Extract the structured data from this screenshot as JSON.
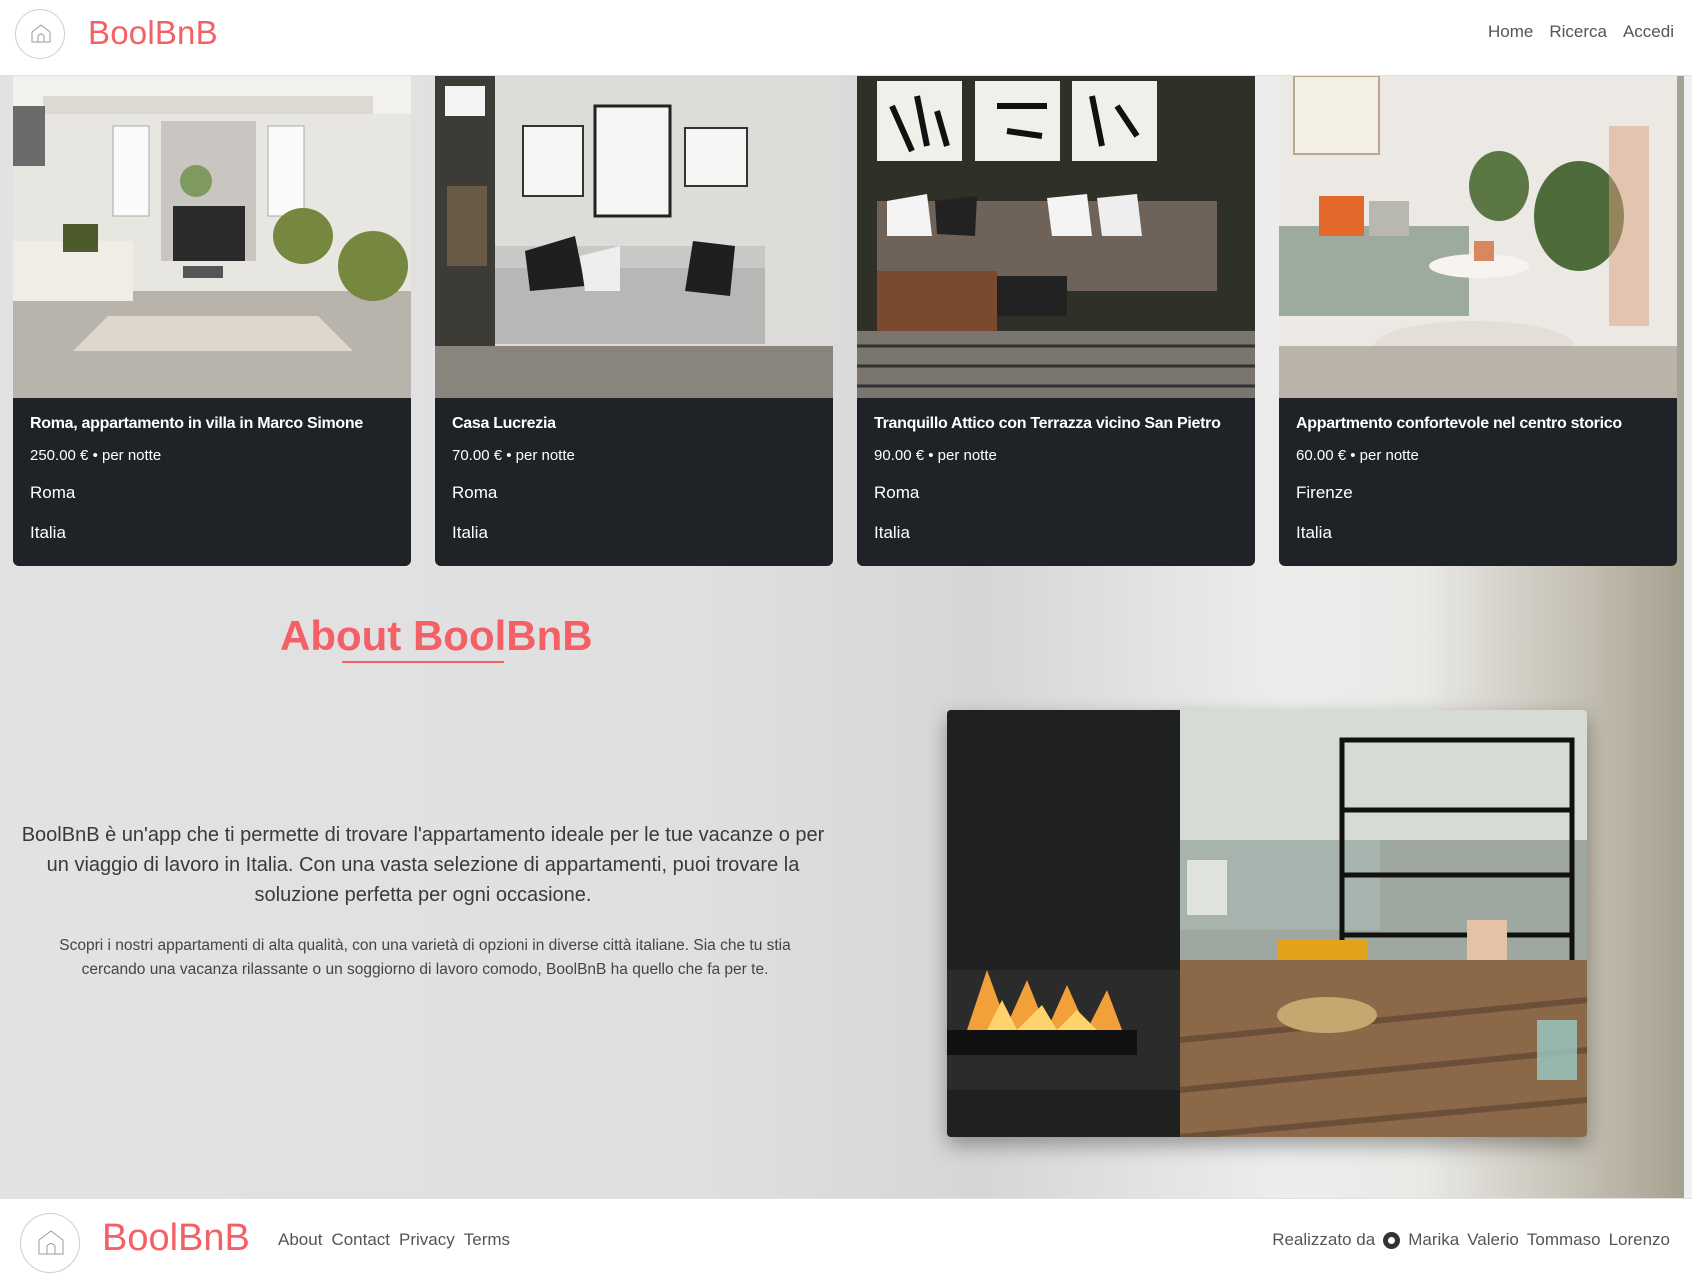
{
  "header": {
    "brand": "BoolBnB",
    "nav": [
      "Home",
      "Ricerca",
      "Accedi"
    ]
  },
  "cards": [
    {
      "title": "Roma, appartamento in villa in Marco Simone",
      "price": "250.00 €",
      "unit": "• per notte",
      "city": "Roma",
      "country": "Italia"
    },
    {
      "title": "Casa Lucrezia",
      "price": "70.00 €",
      "unit": "• per notte",
      "city": "Roma",
      "country": "Italia"
    },
    {
      "title": "Tranquillo Attico con Terrazza vicino San Pietro",
      "price": "90.00 €",
      "unit": "• per notte",
      "city": "Roma",
      "country": "Italia"
    },
    {
      "title": "Appartmento confortevole nel centro storico",
      "price": "60.00 €",
      "unit": "• per notte",
      "city": "Firenze",
      "country": "Italia"
    }
  ],
  "about": {
    "title": "About BoolBnB",
    "lead": "BoolBnB è un'app che ti permette di trovare l'appartamento ideale per le tue vacanze o per un viaggio di lavoro in Italia. Con una vasta selezione di appartamenti, puoi trovare la soluzione perfetta per ogni occasione.",
    "text": "Scopri i nostri appartamenti di alta qualità, con una varietà di opzioni in diverse città italiane. Sia che tu stia cercando una vacanza rilassante o un soggiorno di lavoro comodo, BoolBnB ha quello che fa per te."
  },
  "footer": {
    "brand": "BoolBnB",
    "links": [
      "About",
      "Contact",
      "Privacy",
      "Terms"
    ],
    "credits_label": "Realizzato da",
    "authors": [
      "Marika",
      "Valerio",
      "Tommaso",
      "Lorenzo"
    ]
  },
  "colors": {
    "accent": "#f36066",
    "card_bg": "#1f2227"
  },
  "icons": {
    "header_logo": "house-logo-icon",
    "credits": "github-icon"
  }
}
